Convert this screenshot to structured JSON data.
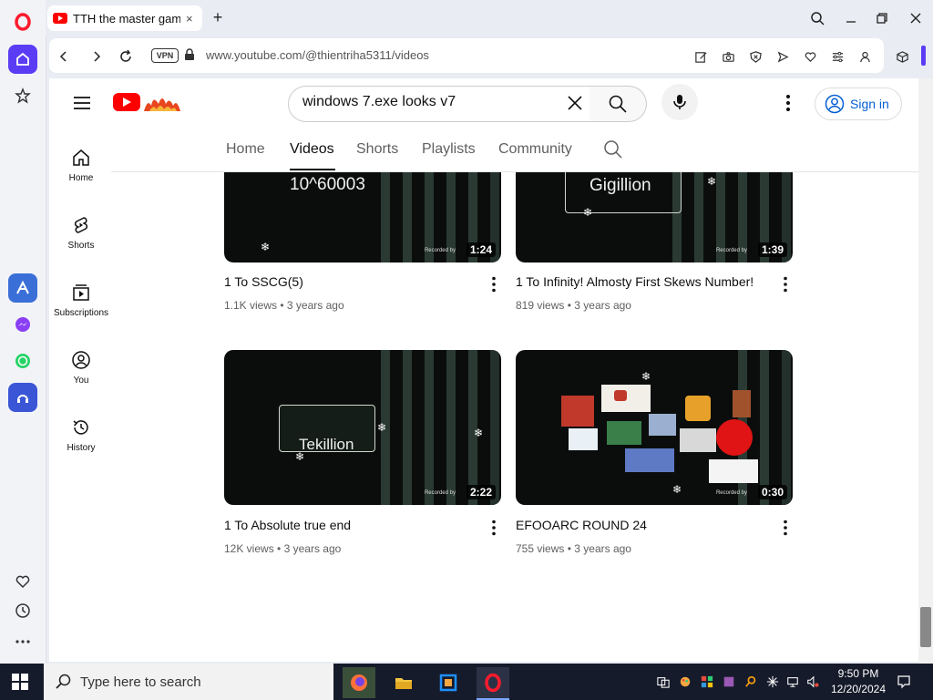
{
  "browser": {
    "tab_title": "TTH the master gamer",
    "tab_close": "×",
    "new_tab": "+",
    "vpn_badge": "VPN",
    "url": "www.youtube.com/@thientriha5311/videos"
  },
  "youtube": {
    "search_query": "windows 7.exe looks v7",
    "sign_in": "Sign in",
    "guide": [
      {
        "label": "Home",
        "icon": "home-icon"
      },
      {
        "label": "Shorts",
        "icon": "shorts-icon"
      },
      {
        "label": "Subscriptions",
        "icon": "subscriptions-icon"
      },
      {
        "label": "You",
        "icon": "you-icon"
      },
      {
        "label": "History",
        "icon": "history-icon"
      }
    ],
    "tabs": [
      {
        "label": "Home"
      },
      {
        "label": "Videos"
      },
      {
        "label": "Shorts"
      },
      {
        "label": "Playlists"
      },
      {
        "label": "Community"
      }
    ],
    "videos": [
      {
        "title": "1 To SSCG(5)",
        "views": "1.1K views",
        "age": "3 years ago",
        "duration": "1:24",
        "thumb_text": "10^60003"
      },
      {
        "title": "1 To Infinity! Almosty First Skews Number!",
        "views": "819 views",
        "age": "3 years ago",
        "duration": "1:39",
        "thumb_text": "Gigillion"
      },
      {
        "title": "1 To Absolute true end",
        "views": "12K views",
        "age": "3 years ago",
        "duration": "2:22",
        "thumb_text": "Tekillion"
      },
      {
        "title": "EFOOARC ROUND 24",
        "views": "755 views",
        "age": "3 years ago",
        "duration": "0:30",
        "thumb_text": ""
      }
    ],
    "meta_separator": "•",
    "recorded_by": "Recorded by"
  },
  "taskbar": {
    "search_placeholder": "Type here to search",
    "time": "9:50 PM",
    "date": "12/20/2024"
  },
  "colors": {
    "opera_red": "#ff1b2d",
    "opera_active": "#5b3cf5",
    "youtube_red": "#ff0000",
    "link_blue": "#065fd4",
    "taskbar": "#161b2b"
  }
}
